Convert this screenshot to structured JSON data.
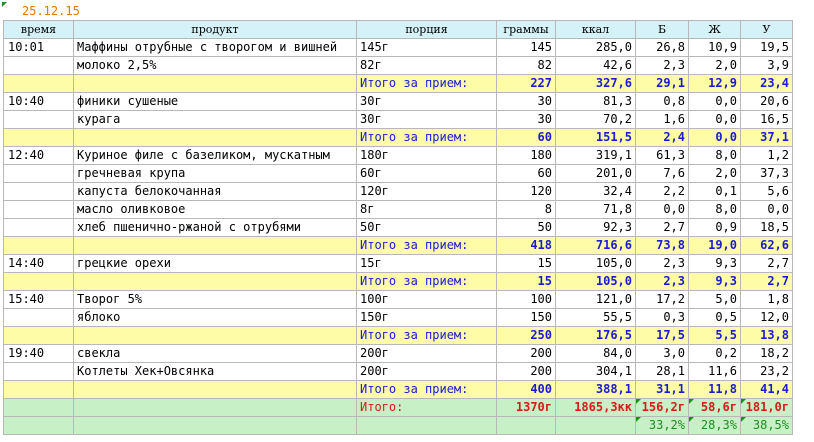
{
  "date": "25.12.15",
  "headers": {
    "time": "время",
    "product": "продукт",
    "portion": "порция",
    "grams": "граммы",
    "kcal": "ккал",
    "b": "Б",
    "zh": "Ж",
    "u": "У"
  },
  "rows": [
    {
      "type": "item",
      "time": "10:01",
      "product": "Маффины отрубные с творогом и вишней",
      "portion": "145г",
      "grams": "145",
      "kcal": "285,0",
      "b": "26,8",
      "zh": "10,9",
      "u": "19,5"
    },
    {
      "type": "item",
      "time": "",
      "product": "молоко 2,5%",
      "portion": "82г",
      "grams": "82",
      "kcal": "42,6",
      "b": "2,3",
      "zh": "2,0",
      "u": "3,9"
    },
    {
      "type": "sub",
      "label": "Итого за прием:",
      "grams": "227",
      "kcal": "327,6",
      "b": "29,1",
      "zh": "12,9",
      "u": "23,4"
    },
    {
      "type": "item",
      "time": "10:40",
      "product": "финики сушеные",
      "portion": "30г",
      "grams": "30",
      "kcal": "81,3",
      "b": "0,8",
      "zh": "0,0",
      "u": "20,6"
    },
    {
      "type": "item",
      "time": "",
      "product": "курага",
      "portion": "30г",
      "grams": "30",
      "kcal": "70,2",
      "b": "1,6",
      "zh": "0,0",
      "u": "16,5"
    },
    {
      "type": "sub",
      "label": "Итого за прием:",
      "grams": "60",
      "kcal": "151,5",
      "b": "2,4",
      "zh": "0,0",
      "u": "37,1"
    },
    {
      "type": "item",
      "time": "12:40",
      "product": "Куриное филе с базеликом, мускатным",
      "portion": "180г",
      "grams": "180",
      "kcal": "319,1",
      "b": "61,3",
      "zh": "8,0",
      "u": "1,2"
    },
    {
      "type": "item",
      "time": "",
      "product": "гречневая крупа",
      "portion": "60г",
      "grams": "60",
      "kcal": "201,0",
      "b": "7,6",
      "zh": "2,0",
      "u": "37,3"
    },
    {
      "type": "item",
      "time": "",
      "product": "капуста белокочанная",
      "portion": "120г",
      "grams": "120",
      "kcal": "32,4",
      "b": "2,2",
      "zh": "0,1",
      "u": "5,6"
    },
    {
      "type": "item",
      "time": "",
      "product": "масло оливковое",
      "portion": "8г",
      "grams": "8",
      "kcal": "71,8",
      "b": "0,0",
      "zh": "8,0",
      "u": "0,0"
    },
    {
      "type": "item",
      "time": "",
      "product": "хлеб пшенично-ржаной с отрубями",
      "portion": "50г",
      "grams": "50",
      "kcal": "92,3",
      "b": "2,7",
      "zh": "0,9",
      "u": "18,5"
    },
    {
      "type": "sub",
      "label": "Итого за прием:",
      "grams": "418",
      "kcal": "716,6",
      "b": "73,8",
      "zh": "19,0",
      "u": "62,6"
    },
    {
      "type": "item",
      "time": "14:40",
      "product": "грецкие орехи",
      "portion": "15г",
      "grams": "15",
      "kcal": "105,0",
      "b": "2,3",
      "zh": "9,3",
      "u": "2,7"
    },
    {
      "type": "sub",
      "label": "Итого за прием:",
      "grams": "15",
      "kcal": "105,0",
      "b": "2,3",
      "zh": "9,3",
      "u": "2,7"
    },
    {
      "type": "item",
      "time": "15:40",
      "product": "Творог 5%",
      "portion": "100г",
      "grams": "100",
      "kcal": "121,0",
      "b": "17,2",
      "zh": "5,0",
      "u": "1,8"
    },
    {
      "type": "item",
      "time": "",
      "product": "яблоко",
      "portion": "150г",
      "grams": "150",
      "kcal": "55,5",
      "b": "0,3",
      "zh": "0,5",
      "u": "12,0"
    },
    {
      "type": "sub",
      "label": "Итого за прием:",
      "grams": "250",
      "kcal": "176,5",
      "b": "17,5",
      "zh": "5,5",
      "u": "13,8"
    },
    {
      "type": "item",
      "time": "19:40",
      "product": "свекла",
      "portion": "200г",
      "grams": "200",
      "kcal": "84,0",
      "b": "3,0",
      "zh": "0,2",
      "u": "18,2"
    },
    {
      "type": "item",
      "time": "",
      "product": "Котлеты Хек+Овсянка",
      "portion": "200г",
      "grams": "200",
      "kcal": "304,1",
      "b": "28,1",
      "zh": "11,6",
      "u": "23,2"
    },
    {
      "type": "sub",
      "label": "Итого за прием:",
      "grams": "400",
      "kcal": "388,1",
      "b": "31,1",
      "zh": "11,8",
      "u": "41,4"
    }
  ],
  "total": {
    "label": "Итого:",
    "grams": "1370г",
    "kcal": "1865,3кк",
    "b": "156,2г",
    "zh": "58,6г",
    "u": "181,0г"
  },
  "percent": {
    "b": "33,2%",
    "zh": "28,3%",
    "u": "38,5%"
  },
  "colors": {
    "header_bg": "#d4f2f8",
    "subtotal_bg": "#fffca8",
    "total_bg": "#c7f0c7",
    "date_color": "#e07a00"
  }
}
